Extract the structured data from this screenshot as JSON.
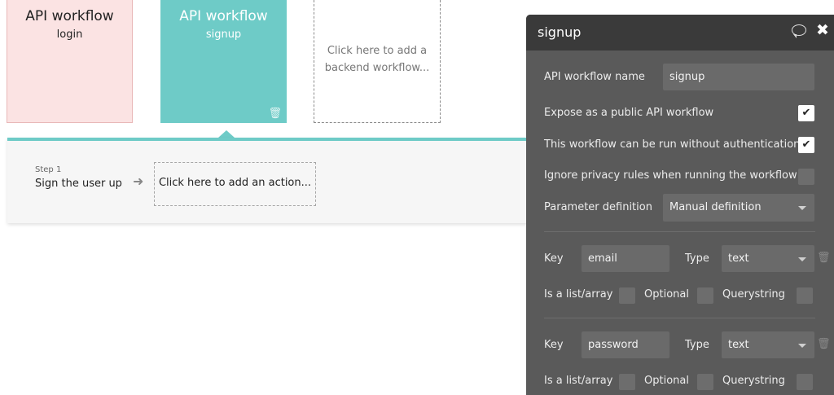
{
  "cards": [
    {
      "title": "API workflow",
      "subtitle": "login"
    },
    {
      "title": "API workflow",
      "subtitle": "signup"
    }
  ],
  "add_card": {
    "line1": "Click here to add a",
    "line2": "backend workflow..."
  },
  "step": {
    "label": "Step 1",
    "name": "Sign the user up",
    "add_action": "Click here to add an action..."
  },
  "editor": {
    "title": "signup",
    "name_label": "API workflow name",
    "name_value": "signup",
    "expose_label": "Expose as a public API workflow",
    "expose_checked": true,
    "noauth_label": "This workflow can be run without authentication",
    "noauth_checked": true,
    "privacy_label": "Ignore privacy rules when running the workflow",
    "privacy_checked": false,
    "param_label": "Parameter definition",
    "param_value": "Manual definition",
    "params": [
      {
        "key_label": "Key",
        "key": "email",
        "type_label": "Type",
        "type": "text",
        "list_label": "Is a list/array",
        "optional_label": "Optional",
        "query_label": "Querystring"
      },
      {
        "key_label": "Key",
        "key": "password",
        "type_label": "Type",
        "type": "text",
        "list_label": "Is a list/array",
        "optional_label": "Optional",
        "query_label": "Querystring"
      }
    ]
  },
  "icons": {
    "trash": "trash-icon",
    "comment": "comment-icon",
    "close": "close-icon",
    "arrow": "arrow-right-icon",
    "check": "✔"
  }
}
